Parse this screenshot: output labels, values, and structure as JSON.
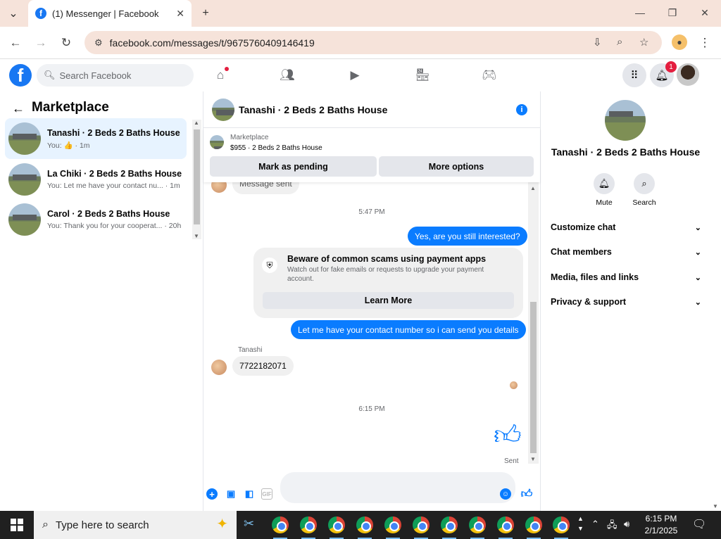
{
  "browser": {
    "tab_title": "(1) Messenger | Facebook",
    "tab_close": "✕",
    "new_tab": "+",
    "url": "facebook.com/messages/t/9675760409146419"
  },
  "fb": {
    "search_placeholder": "Search Facebook",
    "notification_count": "1"
  },
  "sidebar": {
    "title": "Marketplace",
    "conversations": [
      {
        "title": "Tanashi · 2 Beds 2 Baths House",
        "snippet": "You: 👍 · 1m",
        "active": true
      },
      {
        "title": "La Chiki · 2 Beds 2 Baths House",
        "snippet": "You: Let me have your contact nu...  · 1m",
        "active": false
      },
      {
        "title": "Carol · 2 Beds 2 Baths House",
        "snippet": "You: Thank you for your cooperat... · 20h",
        "active": false
      }
    ]
  },
  "chat": {
    "header_name": "Tanashi · 2 Beds 2 Baths House",
    "marketplace_label": "Marketplace",
    "listing": "$955 · 2 Beds 2 Baths House",
    "mark_pending": "Mark as pending",
    "more_options": "More options",
    "partial_message": "Message sent",
    "time_1": "5:47 PM",
    "msg_out_1": "Yes, are you still interested?",
    "scam_title": "Beware of common scams using payment apps",
    "scam_body": "Watch out for fake emails or requests to upgrade your payment account.",
    "learn_more": "Learn More",
    "msg_out_2": "Let me have your contact number so i can send you details",
    "sender_name": "Tanashi",
    "msg_in_1": "7722182071",
    "time_2": "6:15 PM",
    "sent_status": "Sent",
    "composer_placeholder": ""
  },
  "details": {
    "name": "Tanashi · 2 Beds 2 Baths House",
    "mute": "Mute",
    "search": "Search",
    "sections": [
      "Customize chat",
      "Chat members",
      "Media, files and links",
      "Privacy & support"
    ]
  },
  "taskbar": {
    "search_placeholder": "Type here to search",
    "time": "6:15 PM",
    "date": "2/1/2025"
  },
  "colors": {
    "accent": "#0a7cff",
    "fb_blue": "#1877f2",
    "badge": "#e41e3f"
  }
}
